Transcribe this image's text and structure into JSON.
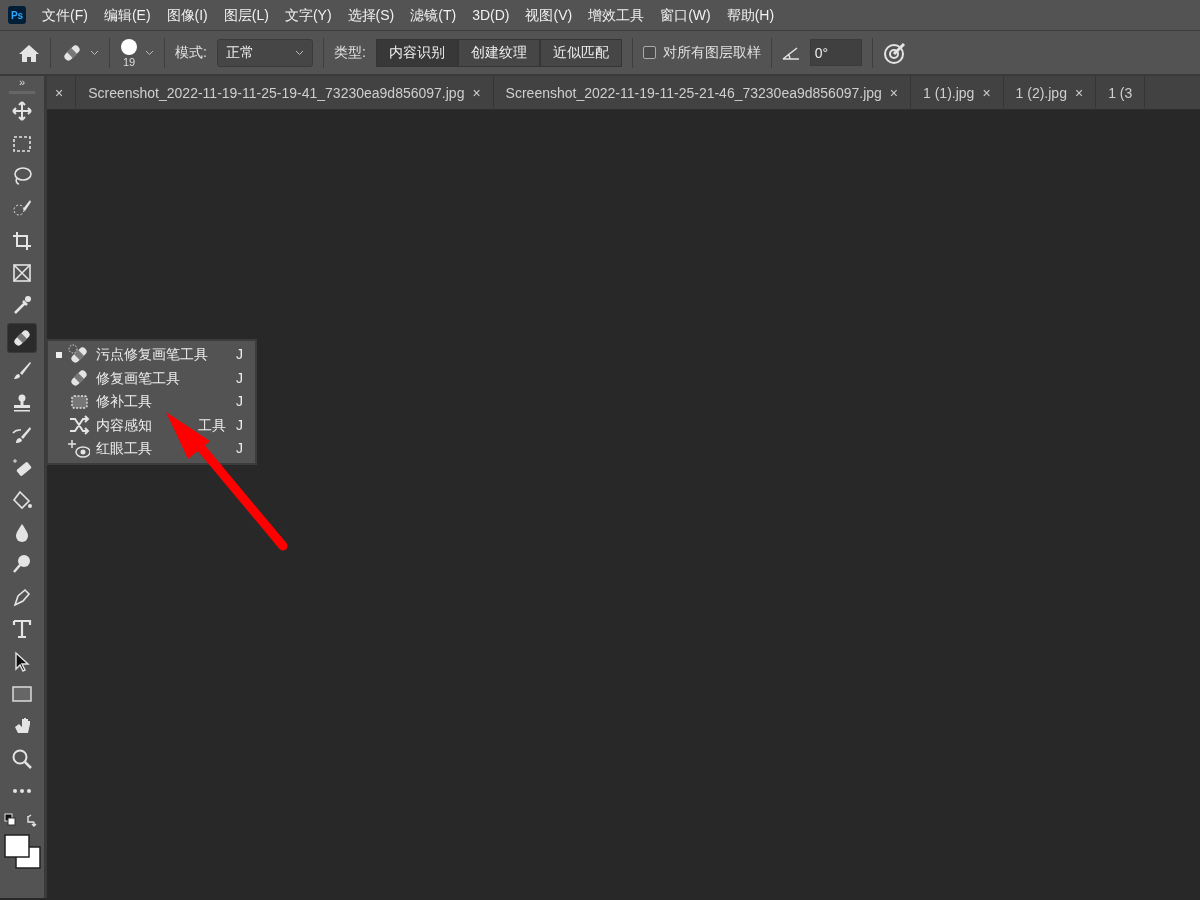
{
  "menu_bar": {
    "logo": "Ps",
    "items": [
      "文件(F)",
      "编辑(E)",
      "图像(I)",
      "图层(L)",
      "文字(Y)",
      "选择(S)",
      "滤镜(T)",
      "3D(D)",
      "视图(V)",
      "增效工具",
      "窗口(W)",
      "帮助(H)"
    ]
  },
  "options_bar": {
    "brush_size": "19",
    "mode_label": "模式:",
    "mode_value": "正常",
    "type_label": "类型:",
    "type_options": [
      {
        "label": "内容识别",
        "selected": true
      },
      {
        "label": "创建纹理",
        "selected": false
      },
      {
        "label": "近似匹配",
        "selected": false
      }
    ],
    "sample_all_layers": {
      "label": "对所有图层取样",
      "checked": false
    },
    "angle_value": "0°"
  },
  "panel_toggle": "»",
  "tabs": [
    {
      "close": "×"
    },
    {
      "label": "Screenshot_2022-11-19-11-25-19-41_73230ea9d856097.jpg",
      "close": "×"
    },
    {
      "label": "Screenshot_2022-11-19-11-25-21-46_73230ea9d856097.jpg",
      "close": "×"
    },
    {
      "label": "1 (1).jpg",
      "close": "×"
    },
    {
      "label": "1 (2).jpg",
      "close": "×"
    },
    {
      "label": "1 (3"
    }
  ],
  "tools": [
    {
      "kind": "move",
      "selected": false
    },
    {
      "kind": "marquee",
      "selected": false
    },
    {
      "kind": "lasso",
      "selected": false
    },
    {
      "kind": "quickselect",
      "selected": false
    },
    {
      "kind": "crop",
      "selected": false
    },
    {
      "kind": "frame",
      "selected": false
    },
    {
      "kind": "eyedropper",
      "selected": false
    },
    {
      "kind": "healing",
      "selected": true
    },
    {
      "kind": "brush",
      "selected": false
    },
    {
      "kind": "stamp",
      "selected": false
    },
    {
      "kind": "historybrush",
      "selected": false
    },
    {
      "kind": "eraser",
      "selected": false
    },
    {
      "kind": "bucket",
      "selected": false
    },
    {
      "kind": "blur",
      "selected": false
    },
    {
      "kind": "dodge",
      "selected": false
    },
    {
      "kind": "pen",
      "selected": false
    },
    {
      "kind": "type",
      "selected": false
    },
    {
      "kind": "pathselect",
      "selected": false
    },
    {
      "kind": "rectangle",
      "selected": false
    },
    {
      "kind": "hand",
      "selected": false
    },
    {
      "kind": "zoom",
      "selected": false
    },
    {
      "kind": "more",
      "selected": false
    }
  ],
  "flyout": [
    {
      "kind": "spot",
      "label": "污点修复画笔工具",
      "shortcut": "J",
      "selected": true
    },
    {
      "kind": "heal",
      "label": "修复画笔工具",
      "shortcut": "J",
      "selected": false
    },
    {
      "kind": "patch",
      "label": "修补工具",
      "shortcut": "J",
      "selected": false
    },
    {
      "kind": "move",
      "label": "内容感知",
      "label_after": "工具",
      "shortcut": "J",
      "selected": false
    },
    {
      "kind": "redeye",
      "label": "红眼工具",
      "shortcut": "J",
      "selected": false
    }
  ],
  "annotation": {
    "kind": "arrow",
    "color": "#ff0000"
  }
}
